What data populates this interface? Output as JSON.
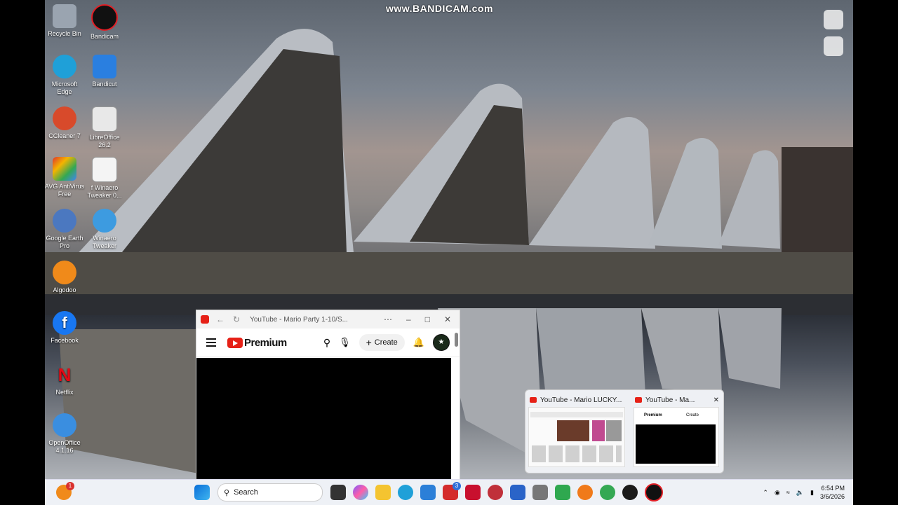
{
  "watermark": "www.BANDICAM.com",
  "desktop_icons": [
    {
      "label": "Recycle Bin",
      "icon": "recycle-bin-icon",
      "color": "#9aa4b0"
    },
    {
      "label": "Bandicam",
      "icon": "bandicam-icon",
      "color": "#e21f26"
    },
    {
      "label": "Microsoft Edge",
      "icon": "edge-icon",
      "color": "#1fa0d8"
    },
    {
      "label": "Bandicut",
      "icon": "bandicut-icon",
      "color": "#2a7fe0"
    },
    {
      "label": "CCleaner 7",
      "icon": "ccleaner-icon",
      "color": "#d84a2b"
    },
    {
      "label": "LibreOffice 26.2",
      "icon": "libreoffice-icon",
      "color": "#e8e8e8"
    },
    {
      "label": "AVG AntiVirus Free",
      "icon": "avg-icon",
      "color": "#e0352b"
    },
    {
      "label": "f Winaero Tweaker 0...",
      "icon": "document-icon",
      "color": "#f4f4f4"
    },
    {
      "label": "Google Earth Pro",
      "icon": "google-earth-icon",
      "color": "#4b78c0"
    },
    {
      "label": "Winaero Tweaker",
      "icon": "winaero-icon",
      "color": "#3d9be0"
    },
    {
      "label": "Algodoo",
      "icon": "algodoo-icon",
      "color": "#f08a1a"
    },
    {
      "label": "Facebook",
      "icon": "facebook-icon",
      "color": "#1877f2"
    },
    {
      "label": "Netflix",
      "icon": "netflix-icon",
      "color": "#e50914"
    },
    {
      "label": "OpenOffice 4.1.16",
      "icon": "openoffice-icon",
      "color": "#3a8ee0"
    }
  ],
  "browser": {
    "title": "YouTube - Mario Party 1-10/S...",
    "logo_text": "Premium",
    "create_label": "Create"
  },
  "preview": {
    "card1_title": "YouTube - Mario LUCKY...",
    "card2_title": "YouTube - Ma...",
    "card2_logo": "Premium",
    "card2_create": "Create"
  },
  "taskbar": {
    "search_placeholder": "Search",
    "badge_count": "3",
    "weather_badge": "1",
    "time": "6:54 PM",
    "date": "3/6/2026"
  },
  "colors": {
    "accent": "#e62117",
    "taskbar_bg": "#eef1f6"
  }
}
